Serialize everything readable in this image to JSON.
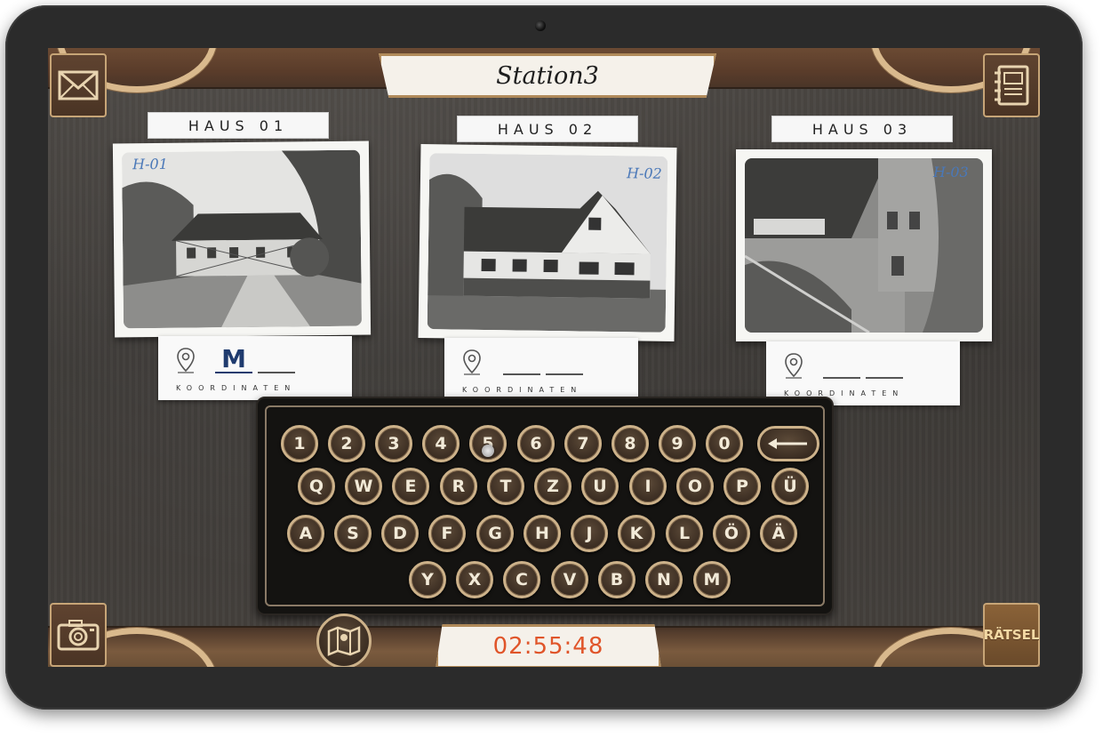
{
  "header": {
    "title": "Station3"
  },
  "corner_buttons": {
    "mail": {
      "icon": "envelope-icon"
    },
    "notebook": {
      "icon": "notebook-icon"
    },
    "camera": {
      "icon": "camera-icon"
    },
    "raetsel": {
      "label": "RÄTSEL"
    }
  },
  "houses": [
    {
      "label": "HAUS 01",
      "photo_tag": "H-01",
      "coordinate_value": "M",
      "coordinate_label": "KOORDINATEN"
    },
    {
      "label": "HAUS 02",
      "photo_tag": "H-02",
      "coordinate_value": "",
      "coordinate_label": "KOORDINATEN"
    },
    {
      "label": "HAUS 03",
      "photo_tag": "H-03",
      "coordinate_value": "",
      "coordinate_label": "KOORDINATEN"
    }
  ],
  "keyboard": {
    "row1": [
      "1",
      "2",
      "3",
      "4",
      "5",
      "6",
      "7",
      "8",
      "9",
      "0"
    ],
    "row2": [
      "Q",
      "W",
      "E",
      "R",
      "T",
      "Z",
      "U",
      "I",
      "O",
      "P",
      "Ü"
    ],
    "row3": [
      "A",
      "S",
      "D",
      "F",
      "G",
      "H",
      "J",
      "K",
      "L",
      "Ö",
      "Ä"
    ],
    "row4": [
      "Y",
      "X",
      "C",
      "V",
      "B",
      "N",
      "M"
    ],
    "backspace_icon": "arrow-left-icon"
  },
  "footer": {
    "map_icon": "map-icon",
    "timer": "02:55:48"
  },
  "colors": {
    "accent_timer": "#e0552a",
    "coordinate_ink": "#1f3b6e",
    "photo_tag": "#4a78b8",
    "key_rim": "#cdb28a"
  }
}
